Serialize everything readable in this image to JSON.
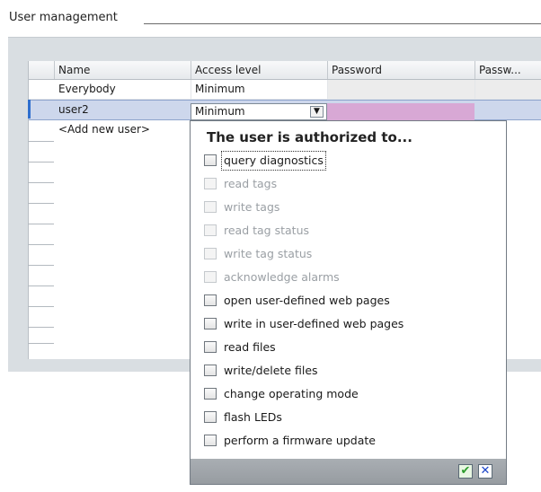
{
  "section": {
    "title": "User management"
  },
  "table": {
    "columns": [
      "Name",
      "Access level",
      "Password",
      "Passw..."
    ],
    "rows": [
      {
        "name": "Everybody",
        "access": "Minimum",
        "password": ""
      },
      {
        "name": "user2",
        "access": "Minimum",
        "password": ""
      },
      {
        "name": "<Add new user>",
        "access": "",
        "password": ""
      }
    ]
  },
  "combo": {
    "value": "Minimum"
  },
  "dropdown": {
    "title": "The user is authorized to...",
    "permissions": [
      {
        "label": "query diagnostics",
        "enabled": true,
        "checked": false
      },
      {
        "label": "read tags",
        "enabled": false,
        "checked": false
      },
      {
        "label": "write tags",
        "enabled": false,
        "checked": false
      },
      {
        "label": "read tag status",
        "enabled": false,
        "checked": false
      },
      {
        "label": "write tag status",
        "enabled": false,
        "checked": false
      },
      {
        "label": "acknowledge alarms",
        "enabled": false,
        "checked": false
      },
      {
        "label": "open user-defined web pages",
        "enabled": true,
        "checked": false
      },
      {
        "label": "write in user-defined web pages",
        "enabled": true,
        "checked": false
      },
      {
        "label": "read files",
        "enabled": true,
        "checked": false
      },
      {
        "label": "write/delete files",
        "enabled": true,
        "checked": false
      },
      {
        "label": "change operating mode",
        "enabled": true,
        "checked": false
      },
      {
        "label": "flash LEDs",
        "enabled": true,
        "checked": false
      },
      {
        "label": "perform a firmware update",
        "enabled": true,
        "checked": false
      }
    ],
    "ok_icon": "check-icon",
    "cancel_icon": "close-icon"
  },
  "colors": {
    "selected_row": "#cdd7ec",
    "password_highlight": "#d8a8d5",
    "ok_green": "#2c9b2c",
    "cancel_blue": "#1b45c8"
  }
}
